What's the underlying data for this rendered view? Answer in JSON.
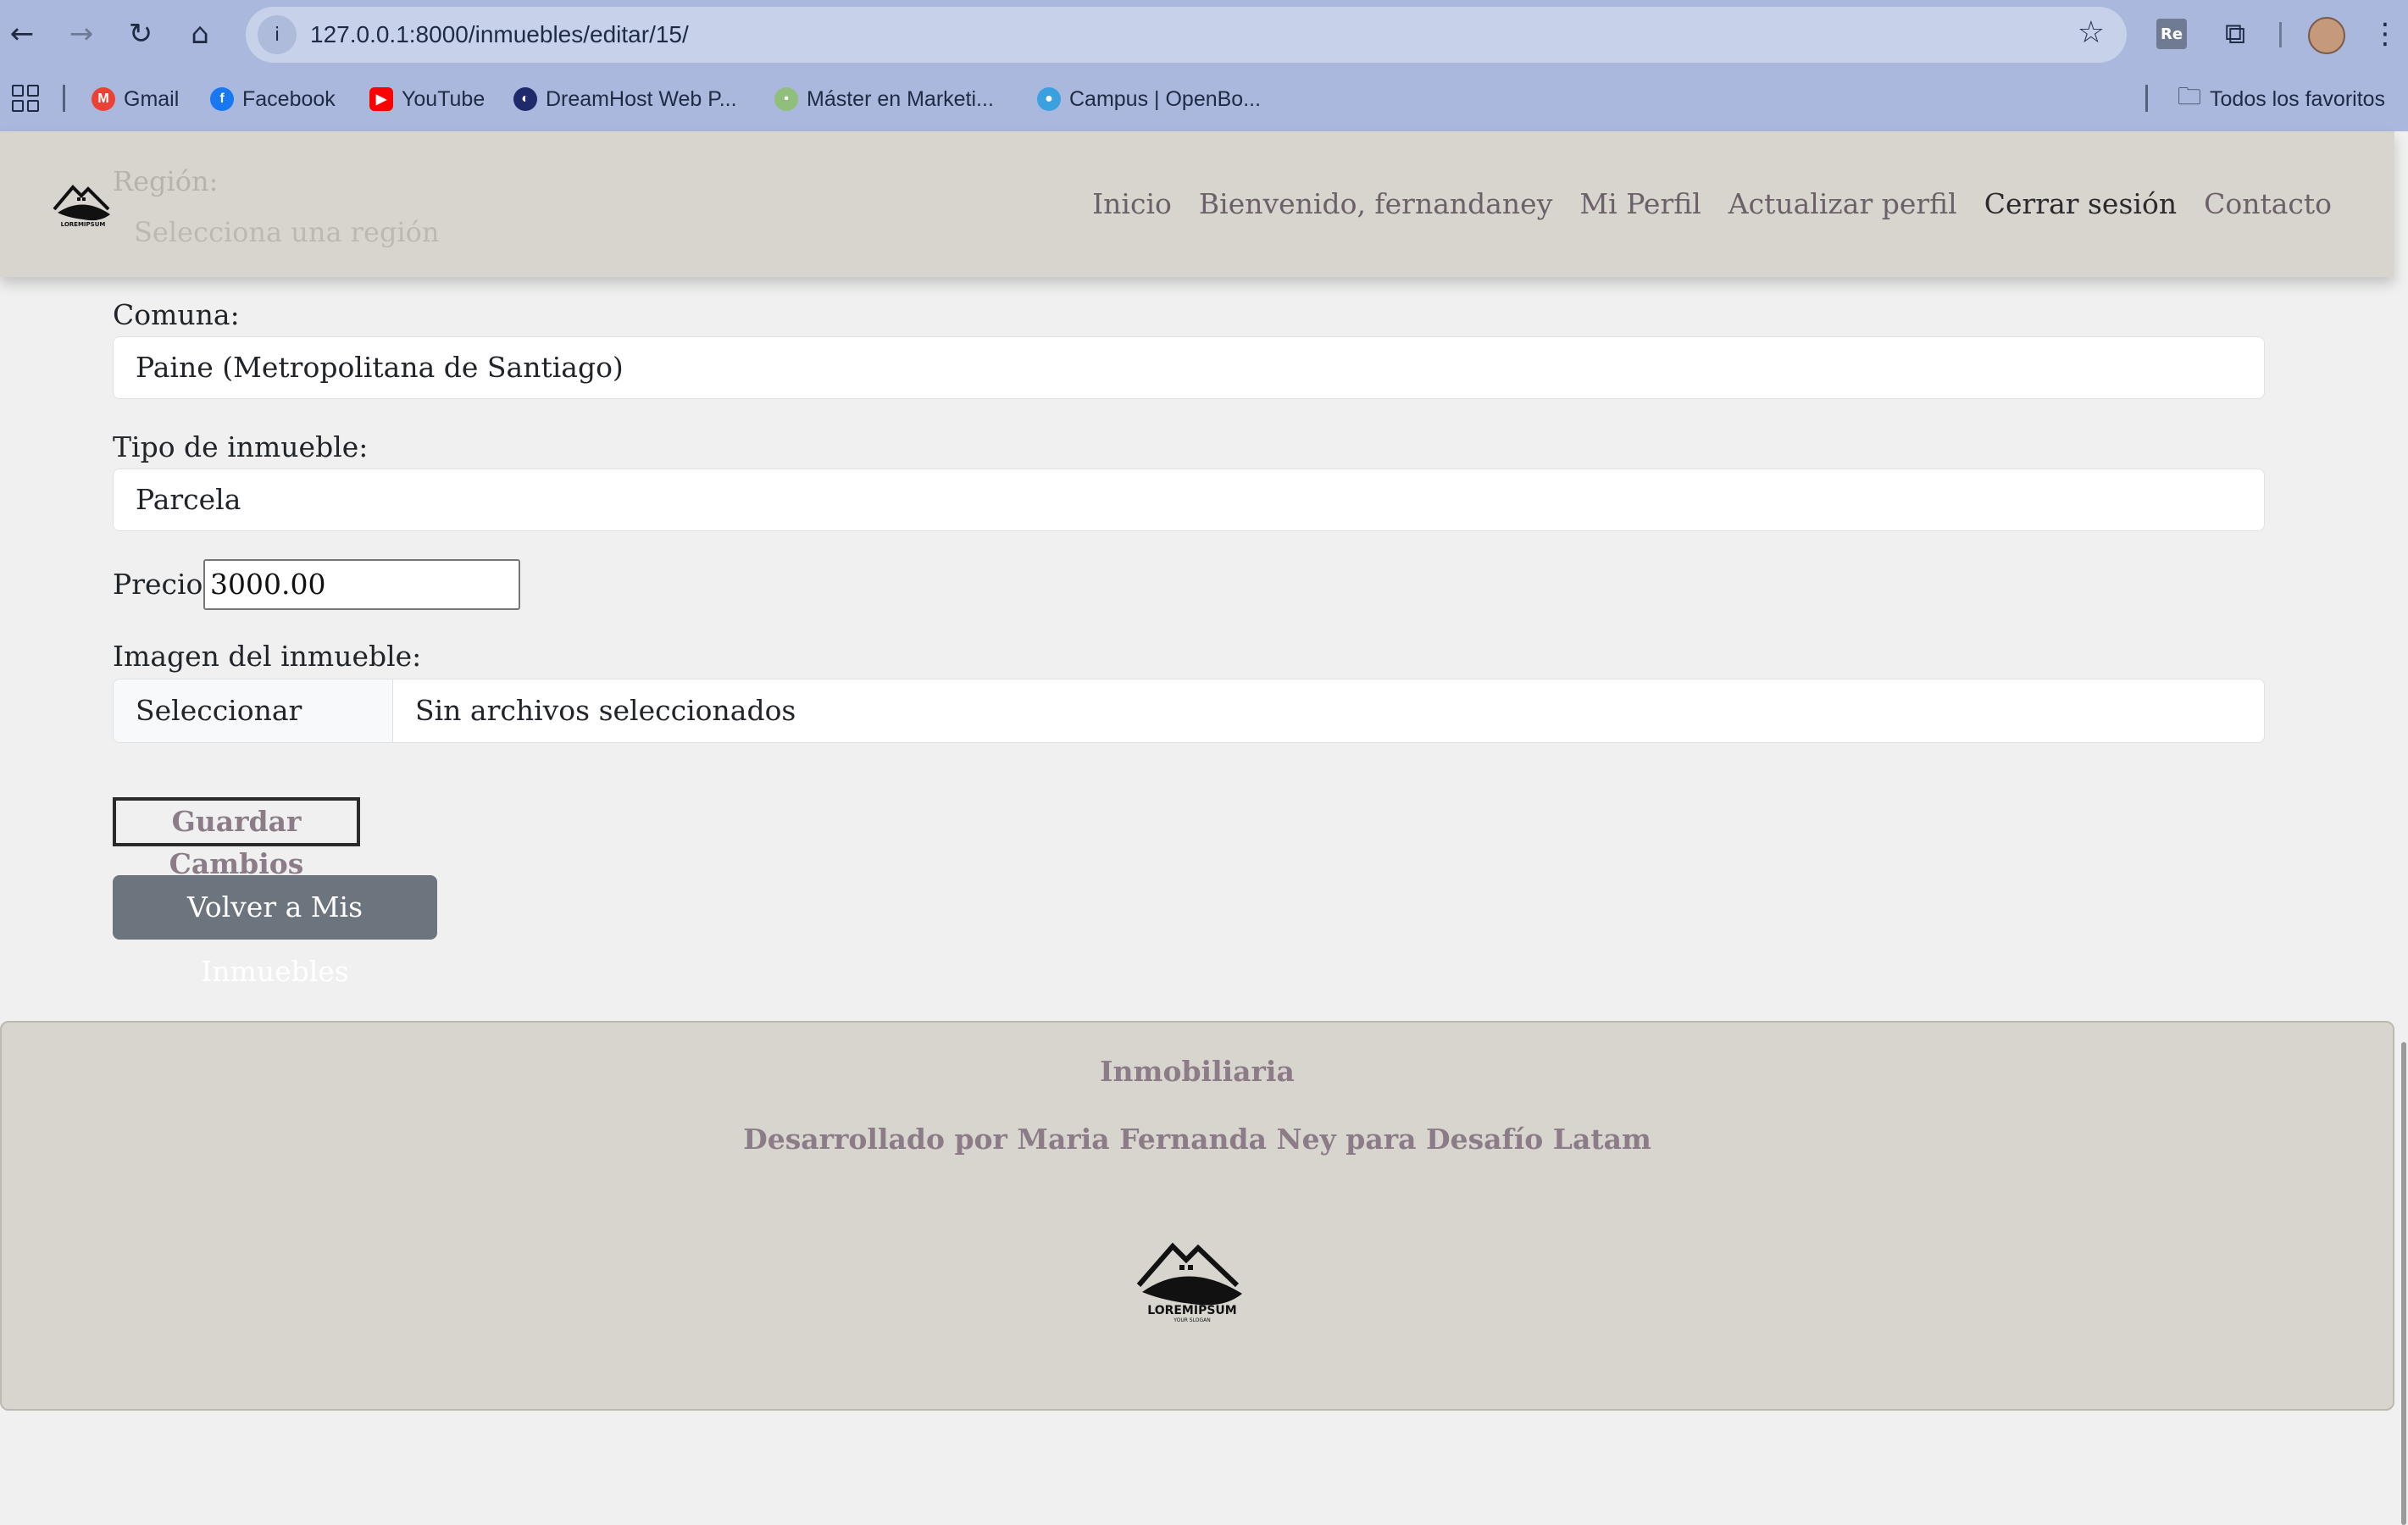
{
  "browser": {
    "url": "127.0.0.1:8000/inmuebles/editar/15/",
    "bookmarks": [
      "Gmail",
      "Facebook",
      "YouTube",
      "DreamHost Web P...",
      "Máster en Marketi...",
      "Campus | OpenBo..."
    ],
    "all_bookmarks_label": "Todos los favoritos",
    "ext_badge": "Re"
  },
  "navbar": {
    "ghost_label": "Región:",
    "ghost_field": "Selecciona una región",
    "logo_text": "LOREMIPSUM",
    "items": [
      "Inicio",
      "Bienvenido, fernandaney",
      "Mi Perfil",
      "Actualizar perfil",
      "Cerrar sesión",
      "Contacto"
    ]
  },
  "form": {
    "comuna_label": "Comuna:",
    "comuna_value": "Paine (Metropolitana de Santiago)",
    "tipo_label": "Tipo de inmueble:",
    "tipo_value": "Parcela",
    "precio_label": "Precio:",
    "precio_value": "3000.00",
    "imagen_label": "Imagen del inmueble:",
    "file_button": "Seleccionar archivo",
    "file_status": "Sin archivos seleccionados",
    "save_button": "Guardar Cambios",
    "back_button": "Volver a Mis Inmuebles"
  },
  "footer": {
    "title": "Inmobiliaria",
    "subtitle": "Desarrollado por Maria Fernanda Ney para Desafío Latam",
    "logo_text": "LOREMIPSUM",
    "logo_slogan": "YOUR SLOGAN"
  },
  "colors": {
    "browser_chrome": "#a9b8dc",
    "navbar_bg": "#d8d5cf",
    "page_bg": "#eff0ef",
    "accent_muted": "#8b7c88",
    "back_button_bg": "#6c757d"
  }
}
